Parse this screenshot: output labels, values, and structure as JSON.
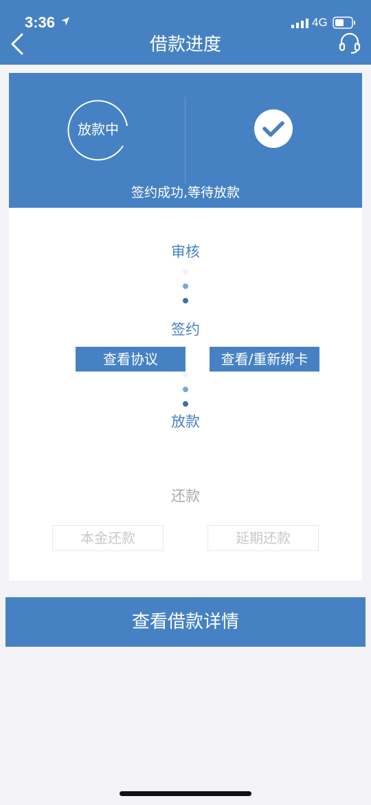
{
  "status_bar": {
    "time": "3:36",
    "network": "4G"
  },
  "nav": {
    "title": "借款进度"
  },
  "header": {
    "ring_label": "放款中",
    "status_text": "签约成功,等待放款"
  },
  "steps": {
    "review": "审核",
    "sign": "签约",
    "disburse": "放款",
    "repay": "还款"
  },
  "buttons": {
    "view_agreement": "查看协议",
    "view_rebind_card": "查看/重新绑卡",
    "principal_repay": "本金还款",
    "extension_repay": "延期还款",
    "view_loan_details": "查看借款详情"
  },
  "colors": {
    "primary": "#4682c3",
    "background": "#f3f3f8",
    "disabled_text": "#c8c8c8"
  }
}
